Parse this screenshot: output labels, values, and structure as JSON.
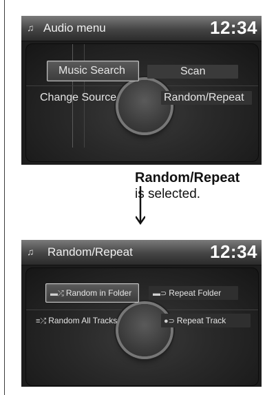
{
  "screen1": {
    "title": "Audio menu",
    "clock": "12:34",
    "menu": [
      {
        "label": "Music Search",
        "selected": true
      },
      {
        "label": "Scan",
        "selected": false
      },
      {
        "label": "Change Source",
        "selected": false
      },
      {
        "label": "Random/Repeat",
        "selected": false
      }
    ]
  },
  "caption": {
    "bold": "Random/Repeat",
    "normal": "is selected."
  },
  "screen2": {
    "title": "Random/Repeat",
    "clock": "12:34",
    "menu": [
      {
        "label": "Random in Folder",
        "selected": true
      },
      {
        "label": "Repeat Folder",
        "selected": false
      },
      {
        "label": "Random All Tracks",
        "selected": false
      },
      {
        "label": "Repeat Track",
        "selected": false
      }
    ]
  }
}
